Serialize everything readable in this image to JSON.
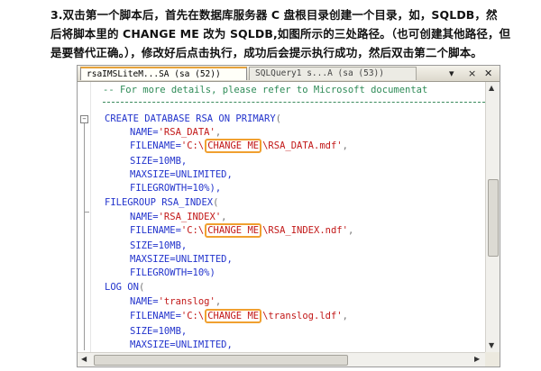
{
  "instructions": {
    "line1": "3.双击第一个脚本后，首先在数据库服务器 C 盘根目录创建一个目录，如，SQLDB，然",
    "line2": "后将脚本里的 CHANGE ME 改为 SQLDB,如图所示的三处路径。（也可创建其他路径，但",
    "line3": "是要替代正确。），修改好后点击执行，成功后会提示执行成功，然后双击第二个脚本。"
  },
  "editor": {
    "tabs": [
      {
        "label": "rsaIMSLiteM...SA (sa (52))",
        "active": true
      },
      {
        "label": "SQLQuery1 s...A (sa (53))",
        "active": false
      }
    ],
    "controls": {
      "dropdown": "▾",
      "close": "✕",
      "tab_close": "×"
    },
    "code": {
      "comment": "-- For more details, please refer to Microsoft documentat",
      "create": "CREATE DATABASE RSA ON PRIMARY",
      "open_paren": "(",
      "name_key": "NAME=",
      "rsa_data_str": "'RSA_DATA'",
      "filename_key": "FILENAME=",
      "path_prefix": "'C:\\",
      "change_me": "CHANGE ME",
      "rsa_data_file": "\\RSA_DATA.mdf'",
      "comma": ",",
      "size": "SIZE=10MB,",
      "maxsize": "MAXSIZE=UNLIMITED,",
      "filegrowth1": "FILEGROWTH=10%),",
      "filegroup": "FILEGROUP RSA_INDEX",
      "rsa_index_str": "'RSA_INDEX'",
      "rsa_index_file": "\\RSA_INDEX.ndf'",
      "filegrowth2": "FILEGROWTH=10%)",
      "log_on": "LOG ON",
      "translog_str": "'translog'",
      "translog_file": "\\translog.ldf'"
    }
  }
}
